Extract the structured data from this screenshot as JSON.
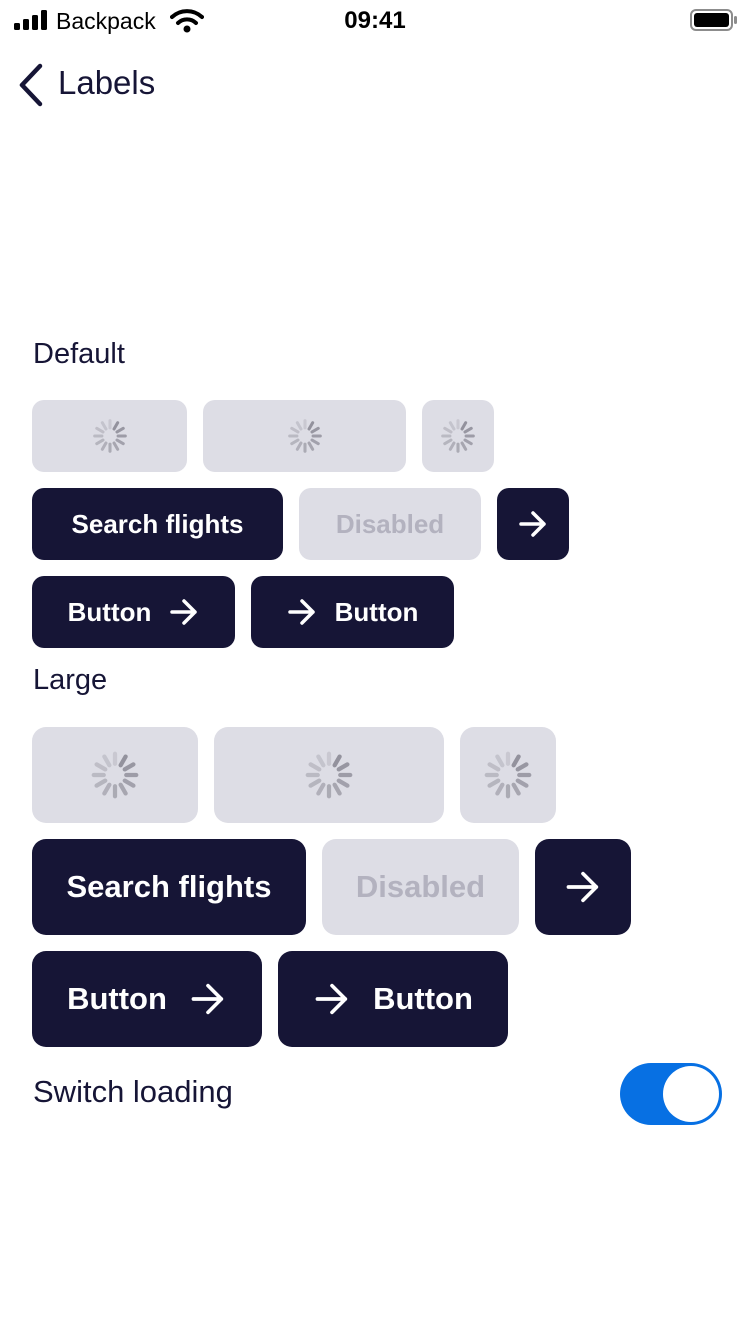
{
  "status_bar": {
    "carrier": "Backpack",
    "time": "09:41"
  },
  "nav": {
    "title": "Labels"
  },
  "sections": {
    "default_label": "Default",
    "large_label": "Large"
  },
  "buttons": {
    "primary_label": "Search flights",
    "disabled_label": "Disabled",
    "icon_label": "Button"
  },
  "switch_row": {
    "label": "Switch loading",
    "on": true
  },
  "colors": {
    "primary": "#161536",
    "disabled_bg": "#dddde5",
    "disabled_text": "#b3b2bf",
    "switch_on": "#0770e3"
  },
  "icons": [
    "signal-icon",
    "wifi-icon",
    "battery-icon",
    "chevron-left-icon",
    "spinner-icon",
    "arrow-right-icon"
  ]
}
